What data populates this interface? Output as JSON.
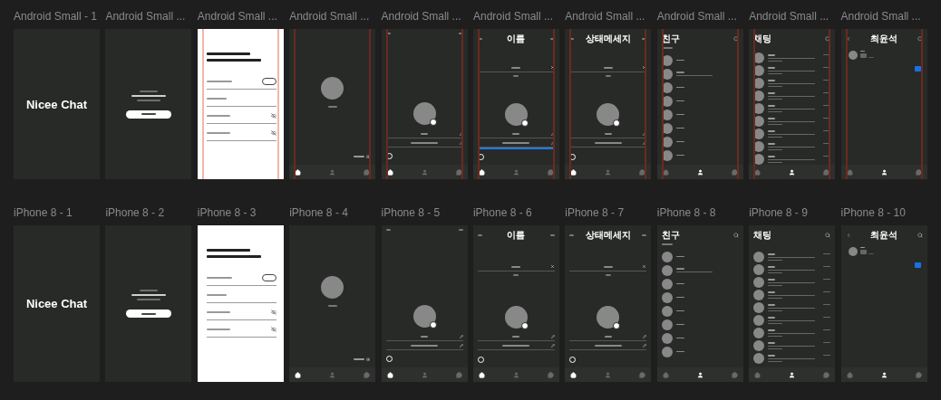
{
  "canvas": {
    "rows": [
      {
        "frames": [
          {
            "title": "Android Small - 1",
            "kind": "splash",
            "app_name": "Nicee Chat",
            "grid_guides": false
          },
          {
            "title": "Android Small ...",
            "kind": "welcome",
            "grid_guides": false
          },
          {
            "title": "Android Small ...",
            "kind": "signup",
            "grid_guides": true
          },
          {
            "title": "Android Small ...",
            "kind": "profile",
            "grid_guides": true,
            "nav": [
              {
                "selected": true
              },
              {
                "selected": false
              },
              {
                "selected": false
              }
            ]
          },
          {
            "title": "Android Small ...",
            "kind": "profile_edit",
            "grid_guides": true,
            "nav": [
              {
                "selected": true
              },
              {
                "selected": false
              },
              {
                "selected": false
              }
            ]
          },
          {
            "title": "Android Small ...",
            "kind": "edit_field",
            "header_title": "이름",
            "focused": true,
            "grid_guides": true,
            "nav": [
              {
                "selected": true
              },
              {
                "selected": false
              },
              {
                "selected": false
              }
            ]
          },
          {
            "title": "Android Small ...",
            "kind": "edit_field",
            "header_title": "상태메세지",
            "focused": false,
            "grid_guides": true,
            "nav": [
              {
                "selected": true
              },
              {
                "selected": false
              },
              {
                "selected": false
              }
            ]
          },
          {
            "title": "Android Small ...",
            "kind": "friends",
            "header_title": "친구",
            "grid_guides": true,
            "rows": [
              {
                "has_status": false
              },
              {
                "has_status": true
              },
              {
                "has_status": false
              },
              {
                "has_status": false
              },
              {
                "has_status": false
              },
              {
                "has_status": false
              },
              {
                "has_status": false
              },
              {
                "has_status": false
              }
            ],
            "nav": [
              {
                "selected": false
              },
              {
                "selected": true
              },
              {
                "selected": false
              }
            ]
          },
          {
            "title": "Android Small ...",
            "kind": "chats",
            "header_title": "채팅",
            "grid_guides": true,
            "rows": [
              {
                "kind": "chat"
              },
              {
                "kind": "chat"
              },
              {
                "kind": "chat"
              },
              {
                "kind": "chat"
              },
              {
                "kind": "chat"
              },
              {
                "kind": "chat"
              },
              {
                "kind": "chat"
              },
              {
                "kind": "chat"
              },
              {
                "kind": "chat"
              }
            ],
            "nav": [
              {
                "selected": false
              },
              {
                "selected": true
              },
              {
                "selected": false
              }
            ]
          },
          {
            "title": "Android Small ...",
            "kind": "chatroom",
            "header_title": "최윤석",
            "grid_guides": true,
            "nav": [
              {
                "selected": false
              },
              {
                "selected": true
              },
              {
                "selected": false
              }
            ]
          }
        ]
      },
      {
        "frames": [
          {
            "title": "iPhone 8 - 1",
            "kind": "splash",
            "app_name": "Nicee Chat",
            "grid_guides": false
          },
          {
            "title": "iPhone 8 - 2",
            "kind": "welcome",
            "grid_guides": false
          },
          {
            "title": "iPhone 8 - 3",
            "kind": "signup",
            "grid_guides": false
          },
          {
            "title": "iPhone 8 - 4",
            "kind": "profile",
            "grid_guides": false,
            "nav": [
              {
                "selected": true
              },
              {
                "selected": false
              },
              {
                "selected": false
              }
            ]
          },
          {
            "title": "iPhone 8 - 5",
            "kind": "profile_edit",
            "grid_guides": false,
            "nav": [
              {
                "selected": true
              },
              {
                "selected": false
              },
              {
                "selected": false
              }
            ]
          },
          {
            "title": "iPhone 8 - 6",
            "kind": "edit_field",
            "header_title": "이름",
            "focused": false,
            "grid_guides": false,
            "nav": [
              {
                "selected": true
              },
              {
                "selected": false
              },
              {
                "selected": false
              }
            ]
          },
          {
            "title": "iPhone 8 - 7",
            "kind": "edit_field",
            "header_title": "상태메세지",
            "focused": false,
            "grid_guides": false,
            "nav": [
              {
                "selected": true
              },
              {
                "selected": false
              },
              {
                "selected": false
              }
            ]
          },
          {
            "title": "iPhone 8 - 8",
            "kind": "friends",
            "header_title": "친구",
            "grid_guides": false,
            "rows": [
              {
                "has_status": false
              },
              {
                "has_status": true
              },
              {
                "has_status": false
              },
              {
                "has_status": false
              },
              {
                "has_status": false
              },
              {
                "has_status": false
              },
              {
                "has_status": false
              },
              {
                "has_status": false
              }
            ],
            "nav": [
              {
                "selected": false
              },
              {
                "selected": true
              },
              {
                "selected": false
              }
            ]
          },
          {
            "title": "iPhone 8 - 9",
            "kind": "chats",
            "header_title": "채팅",
            "grid_guides": false,
            "rows": [
              {
                "kind": "chat"
              },
              {
                "kind": "chat"
              },
              {
                "kind": "chat"
              },
              {
                "kind": "chat"
              },
              {
                "kind": "chat"
              },
              {
                "kind": "chat"
              },
              {
                "kind": "chat"
              },
              {
                "kind": "chat"
              },
              {
                "kind": "chat"
              }
            ],
            "nav": [
              {
                "selected": false
              },
              {
                "selected": true
              },
              {
                "selected": false
              }
            ]
          },
          {
            "title": "iPhone 8 - 10",
            "kind": "chatroom",
            "header_title": "최윤석",
            "grid_guides": false,
            "nav": [
              {
                "selected": false
              },
              {
                "selected": true
              },
              {
                "selected": false
              }
            ]
          }
        ]
      }
    ]
  }
}
